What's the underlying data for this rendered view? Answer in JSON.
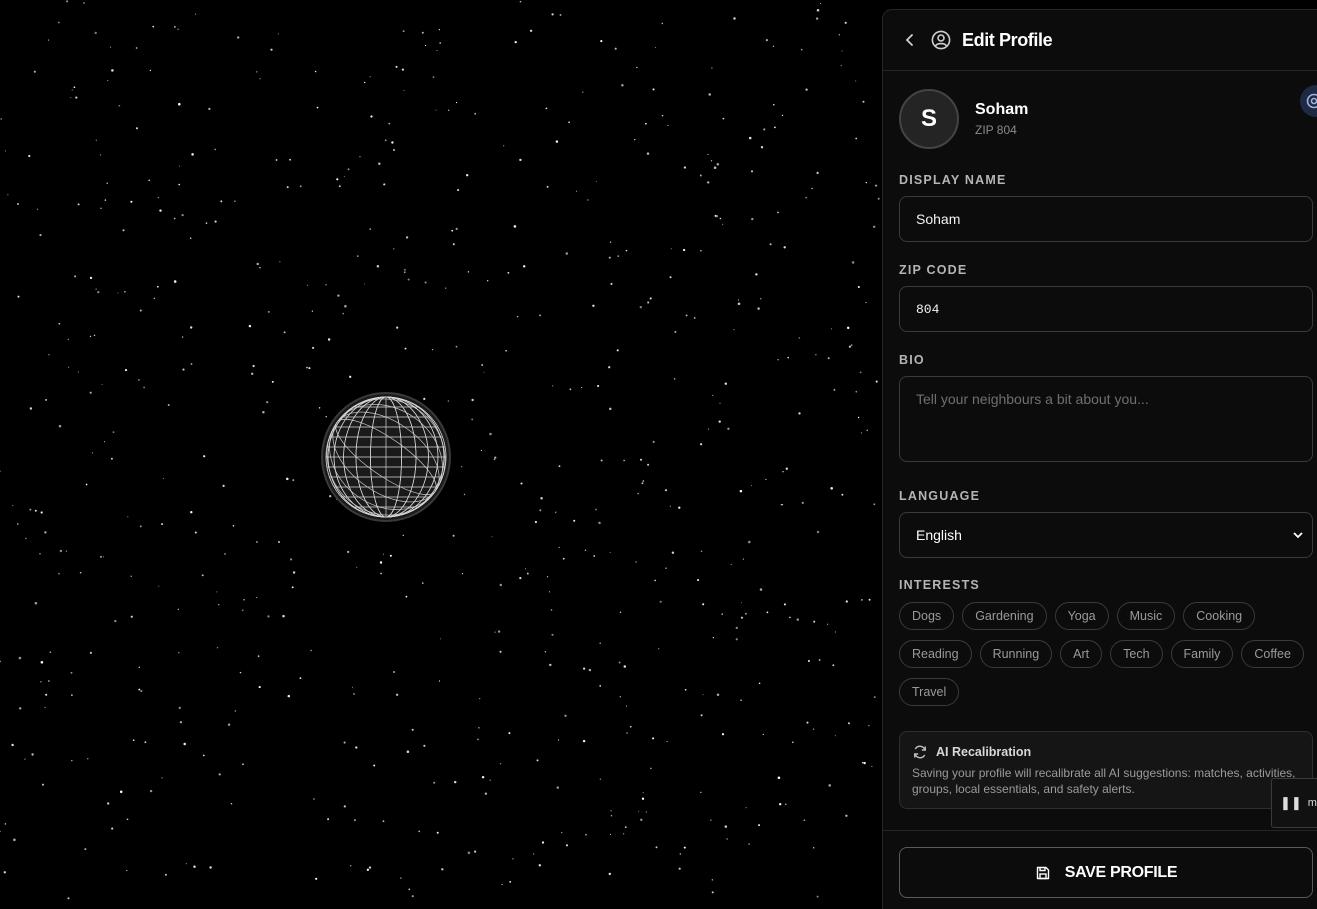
{
  "header": {
    "title": "Edit Profile"
  },
  "profile": {
    "initial": "S",
    "name": "Soham",
    "zip_line": "ZIP 804"
  },
  "form": {
    "display_name": {
      "label": "DISPLAY NAME",
      "value": "Soham"
    },
    "zip_code": {
      "label": "ZIP CODE",
      "value": "804"
    },
    "bio": {
      "label": "BIO",
      "placeholder": "Tell your neighbours a bit about you..."
    },
    "language": {
      "label": "LANGUAGE",
      "value": "English"
    },
    "interests": {
      "label": "INTERESTS",
      "items": [
        "Dogs",
        "Gardening",
        "Yoga",
        "Music",
        "Cooking",
        "Reading",
        "Running",
        "Art",
        "Tech",
        "Family",
        "Coffee",
        "Travel"
      ]
    }
  },
  "recalibration": {
    "title": "AI Recalibration",
    "text": "Saving your profile will recalibrate all AI suggestions: matches, activities, groups, local essentials, and safety alerts."
  },
  "save_button": {
    "label": "SAVE PROFILE"
  },
  "media_player": {
    "label": "me"
  },
  "icons": [
    "chevron-left-icon",
    "user-circle-icon",
    "refresh-icon",
    "save-icon",
    "chevron-down-icon",
    "pause-icon"
  ]
}
